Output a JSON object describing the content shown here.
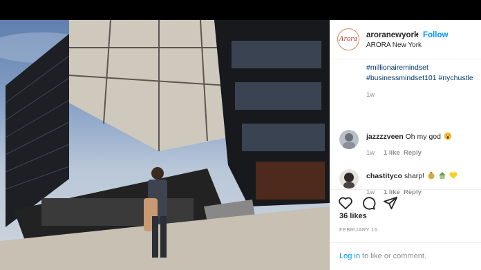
{
  "post": {
    "username": "aroranewyork",
    "separator": "•",
    "follow_label": "Follow",
    "location": "ARORA New York",
    "avatar_text": "Arora"
  },
  "caption": {
    "partial_line": "",
    "hashtags": [
      "#millionairemindset",
      "#businessmindset101 #nychustle"
    ],
    "time": "1w"
  },
  "comments": [
    {
      "user": "jazzzzveen",
      "text": "Oh my god",
      "time": "1w",
      "likes": "1 like",
      "reply": "Reply",
      "icon": "screaming-face-icon"
    },
    {
      "user": "chastityco",
      "text": "sharp!",
      "time": "1w",
      "likes": "1 like",
      "reply": "Reply",
      "icon": "money-bag-house-heart-icons"
    }
  ],
  "actions": {
    "like_icon": "heart-icon",
    "comment_icon": "comment-icon",
    "share_icon": "share-icon"
  },
  "likes_label": "36 likes",
  "date": "FEBRUARY 16",
  "login": {
    "link": "Log in",
    "rest": " to like or comment."
  },
  "colors": {
    "link_blue": "#0095f6",
    "hashtag_blue": "#00376b",
    "muted": "#8e8e8e"
  }
}
